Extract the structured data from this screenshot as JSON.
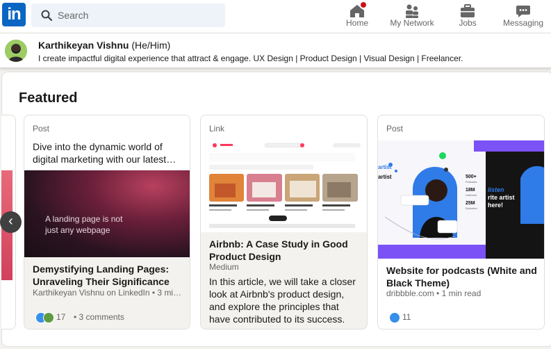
{
  "nav": {
    "logo_text": "in",
    "search_placeholder": "Search",
    "items": [
      {
        "label": "Home",
        "icon": "home-icon"
      },
      {
        "label": "My Network",
        "icon": "network-icon"
      },
      {
        "label": "Jobs",
        "icon": "briefcase-icon"
      },
      {
        "label": "Messaging",
        "icon": "messaging-icon"
      }
    ]
  },
  "profile": {
    "name": "Karthikeyan Vishnu",
    "pronouns": "(He/Him)",
    "headline": "I create impactful digital experience that attract & engage. UX Design | Product Design | Visual Design | Freelancer."
  },
  "featured": {
    "title": "Featured",
    "cards": [
      {
        "type": "Post",
        "text_line1": "Dive into the dynamic world of",
        "text_line2": "digital marketing with our latest…",
        "media_caption_line1": "A landing page is not",
        "media_caption_line2": "just any webpage",
        "title": "Demystifying Landing Pages: Unraveling Their Significance in…",
        "source": "Karthikeyan Vishnu on LinkedIn • 3 mi…",
        "reactions": "17",
        "comments": "• 3 comments"
      },
      {
        "type": "Link",
        "title": "Airbnb: A Case Study in Good Product Design",
        "source": "Medium",
        "description": "In this article, we will take a closer look at Airbnb's product design, and explore the principles that have contributed to its success.",
        "media_brand": "airbnb"
      },
      {
        "type": "Post",
        "media_texts": [
          "artist",
          "listen",
          "rite artist",
          "here!",
          "500+",
          "18M",
          "25M",
          "Listeners",
          "Podcasts",
          "Episodes"
        ],
        "title": "Website for podcasts (White and Black Theme)",
        "source": "dribbble.com • 1 min read",
        "reactions": "11"
      }
    ]
  },
  "colors": {
    "brand": "#0a66c2",
    "notification": "#cc1016",
    "text_secondary": "#666666",
    "podcast_purple": "#7b52f5",
    "podcast_blue": "#2f7be8"
  }
}
